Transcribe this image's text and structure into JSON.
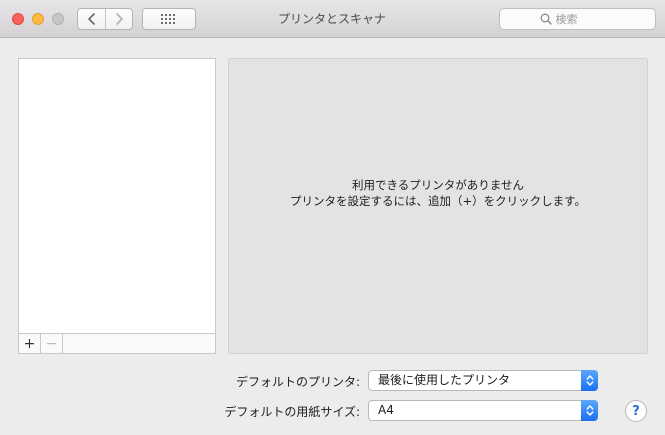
{
  "window": {
    "title": "プリンタとスキャナ"
  },
  "toolbar": {
    "back_icon": "chevron-left-icon",
    "forward_icon": "chevron-right-icon",
    "grid_icon": "grid-icon"
  },
  "search": {
    "placeholder": "検索",
    "icon": "search-icon"
  },
  "printer_list": {
    "items": [],
    "add_label": "+",
    "remove_label": "−"
  },
  "detail": {
    "message_line1": "利用できるプリンタがありません",
    "message_line2": "プリンタを設定するには、追加（+）をクリックします。"
  },
  "defaults": {
    "printer_label": "デフォルトのプリンタ:",
    "printer_value": "最後に使用したプリンタ",
    "paper_label": "デフォルトの用紙サイズ:",
    "paper_value": "A4"
  },
  "help": {
    "label": "?"
  },
  "colors": {
    "close": "#fc605c",
    "minimize": "#fdbc40",
    "zoom_disabled": "#c8c6c8",
    "accent": "#1a6ff0"
  }
}
